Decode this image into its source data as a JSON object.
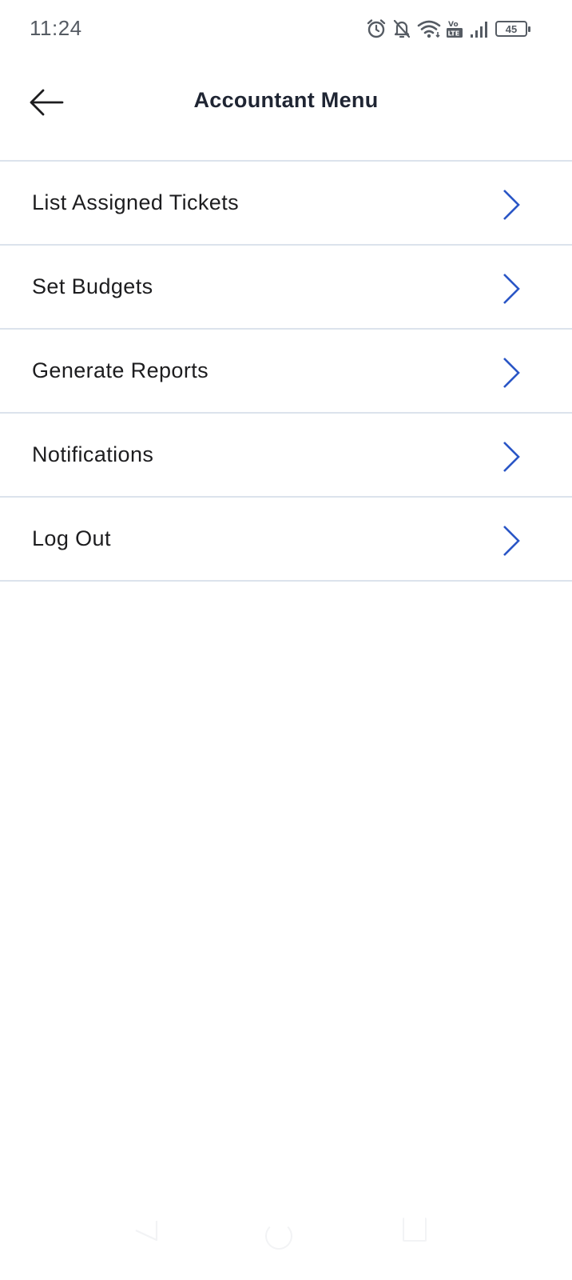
{
  "status_bar": {
    "time": "11:24",
    "icons": [
      "alarm-icon",
      "bell-off-icon",
      "wifi-icon",
      "volte-icon",
      "signal-icon"
    ],
    "volte_label": "Vo LTE",
    "battery_level": "45"
  },
  "header": {
    "title": "Accountant Menu",
    "back_icon": "arrow-left-icon"
  },
  "menu": {
    "items": [
      {
        "label": "List Assigned Tickets"
      },
      {
        "label": "Set Budgets"
      },
      {
        "label": "Generate Reports"
      },
      {
        "label": "Notifications"
      },
      {
        "label": "Log Out"
      }
    ],
    "chevron_icon": "chevron-right-icon"
  },
  "colors": {
    "accent": "#2a56c6",
    "divider": "#dce3ec",
    "text": "#1d1d1f",
    "title": "#1f2533",
    "status": "#555b63"
  },
  "nav_bar": {
    "icons": [
      "nav-back-icon",
      "nav-home-icon",
      "nav-recents-icon"
    ]
  }
}
